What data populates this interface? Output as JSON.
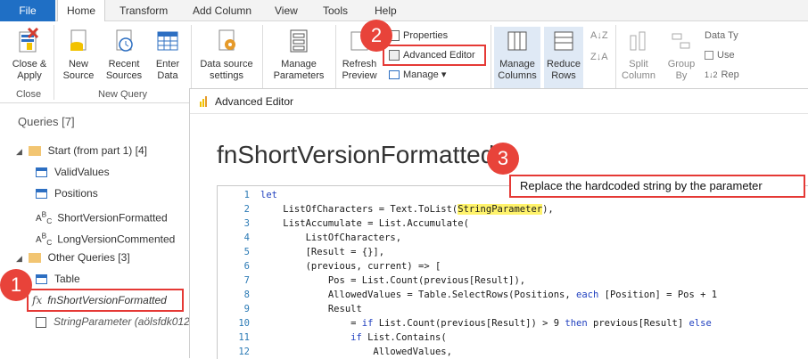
{
  "menu": {
    "items": [
      "File",
      "Home",
      "Transform",
      "Add Column",
      "View",
      "Tools",
      "Help"
    ]
  },
  "ribbon": {
    "close_apply": "Close &\nApply",
    "close_group": "Close",
    "new_source": "New\nSource",
    "recent_sources": "Recent\nSources",
    "enter_data": "Enter\nData",
    "new_query_group": "New Query",
    "data_source_settings": "Data source\nsettings",
    "manage_parameters": "Manage\nParameters",
    "refresh_preview": "Refresh\nPreview",
    "properties": "Properties",
    "advanced_editor": "Advanced Editor",
    "manage": "Manage",
    "manage_columns": "Manage\nColumns",
    "reduce_rows": "Reduce\nRows",
    "split_column": "Split\nColumn",
    "group_by": "Group\nBy",
    "data_type": "Data Ty",
    "use": "Use",
    "replace": "Rep"
  },
  "queries": {
    "header": "Queries [7]",
    "group1": "Start (from part 1) [4]",
    "g1_items": [
      "ValidValues",
      "Positions",
      "ShortVersionFormatted",
      "LongVersionCommented"
    ],
    "group2": "Other Queries [3]",
    "g2_items": [
      "Table",
      "fnShortVersionFormatted",
      "StringParameter (aölsfdk012"
    ]
  },
  "editor": {
    "window_title": "Advanced Editor",
    "function_name": "fnShortVersionFormatted",
    "callout": "Replace the hardcoded string by the parameter",
    "lines": [
      {
        "n": "1",
        "t": "let"
      },
      {
        "n": "2",
        "t": "    ListOfCharacters = Text.ToList(",
        "hl": "StringParameter",
        "t2": "),"
      },
      {
        "n": "3",
        "t": "    ListAccumulate = List.Accumulate("
      },
      {
        "n": "4",
        "t": "        ListOfCharacters,"
      },
      {
        "n": "5",
        "t": "        [Result = {}],"
      },
      {
        "n": "6",
        "t": "        (previous, current) => ["
      },
      {
        "n": "7",
        "t": "            Pos = List.Count(previous[Result]),"
      },
      {
        "n": "8",
        "t": "            AllowedValues = Table.SelectRows(Positions, each [Position] = Pos + 1"
      },
      {
        "n": "9",
        "t": "            Result"
      },
      {
        "n": "10",
        "t": "                = if List.Count(previous[Result]) > 9 then previous[Result] else"
      },
      {
        "n": "11",
        "t": "                if List.Contains("
      },
      {
        "n": "12",
        "t": "                    AllowedValues,"
      }
    ]
  },
  "badges": [
    "1",
    "2",
    "3"
  ],
  "colors": {
    "accent": "#1f6fc5",
    "badge": "#e8433a",
    "highlight": "#fff36b",
    "keyword": "#1f3fbf"
  }
}
